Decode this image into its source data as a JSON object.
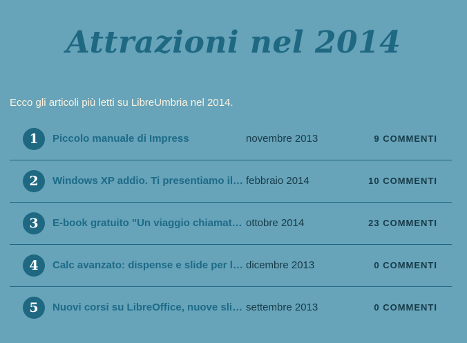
{
  "page": {
    "title": "Attrazioni nel 2014",
    "intro": "Ecco gli articoli più letti su LibreUmbria nel 2014."
  },
  "articles": [
    {
      "rank": "1",
      "title": "Piccolo manuale di Impress",
      "date": "novembre 2013",
      "comments": "9 COMMENTI"
    },
    {
      "rank": "2",
      "title": "Windows XP addio. Ti presentiamo il s…",
      "date": "febbraio 2014",
      "comments": "10 COMMENTI"
    },
    {
      "rank": "3",
      "title": "E-book gratuito \"Un viaggio chiamato …",
      "date": "ottobre 2014",
      "comments": "23 COMMENTI"
    },
    {
      "rank": "4",
      "title": "Calc avanzato: dispense e slide per la le…",
      "date": "dicembre 2013",
      "comments": "0 COMMENTI"
    },
    {
      "rank": "5",
      "title": "Nuovi corsi su LibreOffice, nuove slide …",
      "date": "settembre 2013",
      "comments": "0 COMMENTI"
    }
  ]
}
